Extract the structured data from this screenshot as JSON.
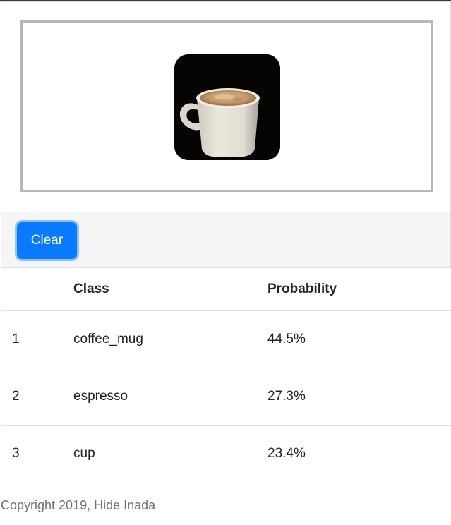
{
  "upload": {
    "preview_image": "coffee-mug-photo"
  },
  "actions": {
    "clear_label": "Clear",
    "clear_color": "#0a7bff"
  },
  "results": {
    "headers": [
      "",
      "Class",
      "Probability"
    ],
    "rows": [
      {
        "rank": "1",
        "class": "coffee_mug",
        "probability": "44.5%"
      },
      {
        "rank": "2",
        "class": "espresso",
        "probability": "27.3%"
      },
      {
        "rank": "3",
        "class": "cup",
        "probability": "23.4%"
      }
    ]
  },
  "footer": {
    "copyright": "Copyright 2019, Hide Inada"
  }
}
